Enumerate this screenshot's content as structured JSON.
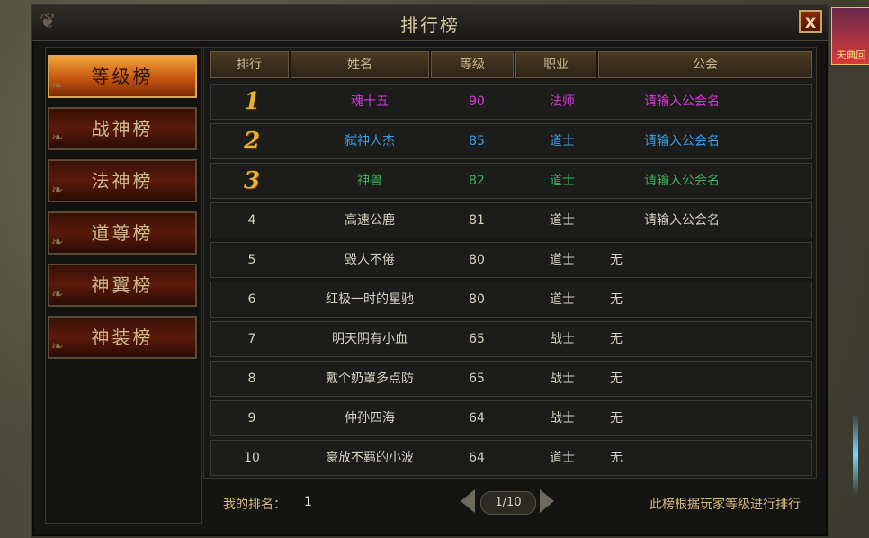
{
  "window": {
    "title": "排行榜",
    "close_label": "X"
  },
  "side_event": {
    "label": "天典回"
  },
  "tabs": [
    {
      "label": "等级榜",
      "active": true
    },
    {
      "label": "战神榜",
      "active": false
    },
    {
      "label": "法神榜",
      "active": false
    },
    {
      "label": "道尊榜",
      "active": false
    },
    {
      "label": "神翼榜",
      "active": false
    },
    {
      "label": "神装榜",
      "active": false
    }
  ],
  "table": {
    "headers": [
      "排行",
      "姓名",
      "等级",
      "职业",
      "公会"
    ],
    "rows": [
      {
        "rank": "1",
        "name": "魂十五",
        "level": "90",
        "job": "法师",
        "guild": "请输入公会名",
        "color": "#d43ad8"
      },
      {
        "rank": "2",
        "name": "弑神人杰",
        "level": "85",
        "job": "道士",
        "guild": "请输入公会名",
        "color": "#3a9ee8"
      },
      {
        "rank": "3",
        "name": "神兽",
        "level": "82",
        "job": "道士",
        "guild": "请输入公会名",
        "color": "#3ab25a"
      },
      {
        "rank": "4",
        "name": "高速公鹿",
        "level": "81",
        "job": "道士",
        "guild": "请输入公会名",
        "color": "#d6d0c2"
      },
      {
        "rank": "5",
        "name": "毁人不倦",
        "level": "80",
        "job": "道士",
        "guild": "无",
        "color": "#d6d0c2"
      },
      {
        "rank": "6",
        "name": "红极一时的星驰",
        "level": "80",
        "job": "道士",
        "guild": "无",
        "color": "#d6d0c2"
      },
      {
        "rank": "7",
        "name": "明天阴有小血",
        "level": "65",
        "job": "战士",
        "guild": "无",
        "color": "#d6d0c2"
      },
      {
        "rank": "8",
        "name": "戴个奶罩多点防",
        "level": "65",
        "job": "战士",
        "guild": "无",
        "color": "#d6d0c2"
      },
      {
        "rank": "9",
        "name": "仲孙四海",
        "level": "64",
        "job": "战士",
        "guild": "无",
        "color": "#d6d0c2"
      },
      {
        "rank": "10",
        "name": "豪放不羁的小波",
        "level": "64",
        "job": "道士",
        "guild": "无",
        "color": "#d6d0c2"
      }
    ]
  },
  "footer": {
    "my_rank_label": "我的排名：",
    "my_rank_value": "1",
    "page": "1/10",
    "note": "此榜根据玩家等级进行排行"
  }
}
